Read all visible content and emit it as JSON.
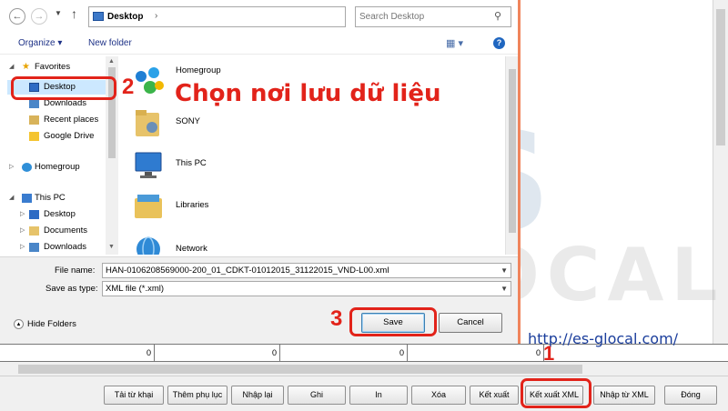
{
  "dialog": {
    "address_path": "Desktop",
    "search_placeholder": "Search Desktop",
    "toolbar": {
      "organize": "Organize",
      "new_folder": "New folder"
    },
    "nav_items": [
      {
        "label": "Favorites",
        "icon": "star-icon"
      },
      {
        "label": "Desktop",
        "icon": "desktop-icon"
      },
      {
        "label": "Downloads",
        "icon": "downloads-icon"
      },
      {
        "label": "Recent places",
        "icon": "recent-places-icon"
      },
      {
        "label": "Google Drive",
        "icon": "google-drive-icon"
      },
      {
        "label": "Homegroup",
        "icon": "homegroup-icon"
      },
      {
        "label": "This PC",
        "icon": "computer-icon"
      },
      {
        "label": "Desktop",
        "icon": "desktop-icon"
      },
      {
        "label": "Documents",
        "icon": "documents-icon"
      },
      {
        "label": "Downloads",
        "icon": "downloads-icon"
      }
    ],
    "files": [
      {
        "label": "Homegroup",
        "icon": "homegroup-icon"
      },
      {
        "label": "SONY",
        "icon": "user-folder-icon"
      },
      {
        "label": "This PC",
        "icon": "computer-icon"
      },
      {
        "label": "Libraries",
        "icon": "libraries-icon"
      },
      {
        "label": "Network",
        "icon": "network-icon"
      }
    ],
    "file_name_label": "File name:",
    "file_name_value": "HAN-0106208569000-200_01_CDKT-01012015_31122015_VND-L00.xml",
    "save_type_label": "Save as type:",
    "save_type_value": "XML file (*.xml)",
    "hide_folders": "Hide Folders",
    "save_label": "Save",
    "cancel_label": "Cancel"
  },
  "annotations": {
    "step1": "1",
    "step2": "2",
    "step3": "3",
    "caption": "Chọn nơi lưu dữ liệu",
    "url": "http://es-glocal.com/"
  },
  "watermark": {
    "line1": "ES",
    "line2": "GLOCAL"
  },
  "table_cells": [
    "0",
    "0",
    "0",
    "0"
  ],
  "bottom_buttons": [
    "Tải từ khại",
    "Thêm phụ lục",
    "Nhập lại",
    "Ghi",
    "In",
    "Xóa",
    "Kết xuất",
    "Kết xuất XML",
    "Nhập từ XML",
    "Đóng"
  ],
  "colors": {
    "annotation_red": "#e2231a",
    "dialog_border": "#f0845c",
    "url_blue": "#1b3e9c"
  }
}
